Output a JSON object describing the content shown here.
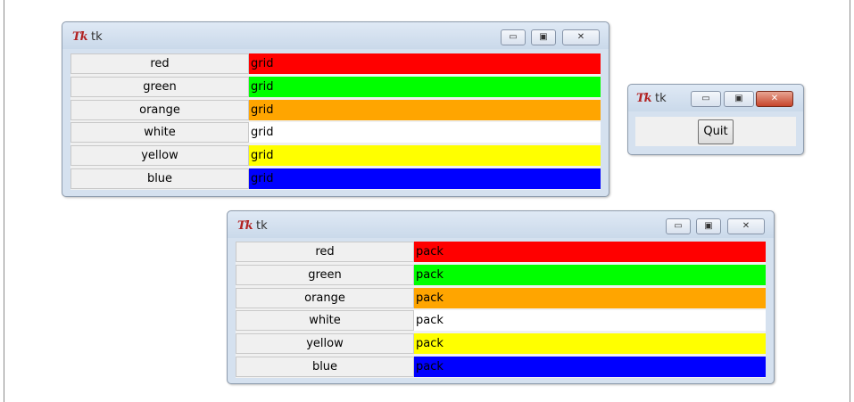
{
  "windows": {
    "grid": {
      "title": "tk",
      "logo": "Tk",
      "controls": {
        "minimize": "▭",
        "maximize": "▣",
        "close": "✕"
      },
      "rows": [
        {
          "label": "red",
          "value": "grid",
          "color": "#ff0000"
        },
        {
          "label": "green",
          "value": "grid",
          "color": "#00ff00"
        },
        {
          "label": "orange",
          "value": "grid",
          "color": "#ffa500"
        },
        {
          "label": "white",
          "value": "grid",
          "color": "#ffffff"
        },
        {
          "label": "yellow",
          "value": "grid",
          "color": "#ffff00"
        },
        {
          "label": "blue",
          "value": "grid",
          "color": "#0000ff"
        }
      ]
    },
    "quit": {
      "title": "tk",
      "logo": "Tk",
      "controls": {
        "minimize": "▭",
        "maximize": "▣",
        "close": "✕"
      },
      "button_label": "Quit"
    },
    "pack": {
      "title": "tk",
      "logo": "Tk",
      "controls": {
        "minimize": "▭",
        "maximize": "▣",
        "close": "✕"
      },
      "rows": [
        {
          "label": "red",
          "value": "pack",
          "color": "#ff0000"
        },
        {
          "label": "green",
          "value": "pack",
          "color": "#00ff00"
        },
        {
          "label": "orange",
          "value": "pack",
          "color": "#ffa500"
        },
        {
          "label": "white",
          "value": "pack",
          "color": "#ffffff"
        },
        {
          "label": "yellow",
          "value": "pack",
          "color": "#ffff00"
        },
        {
          "label": "blue",
          "value": "pack",
          "color": "#0000ff"
        }
      ]
    }
  }
}
